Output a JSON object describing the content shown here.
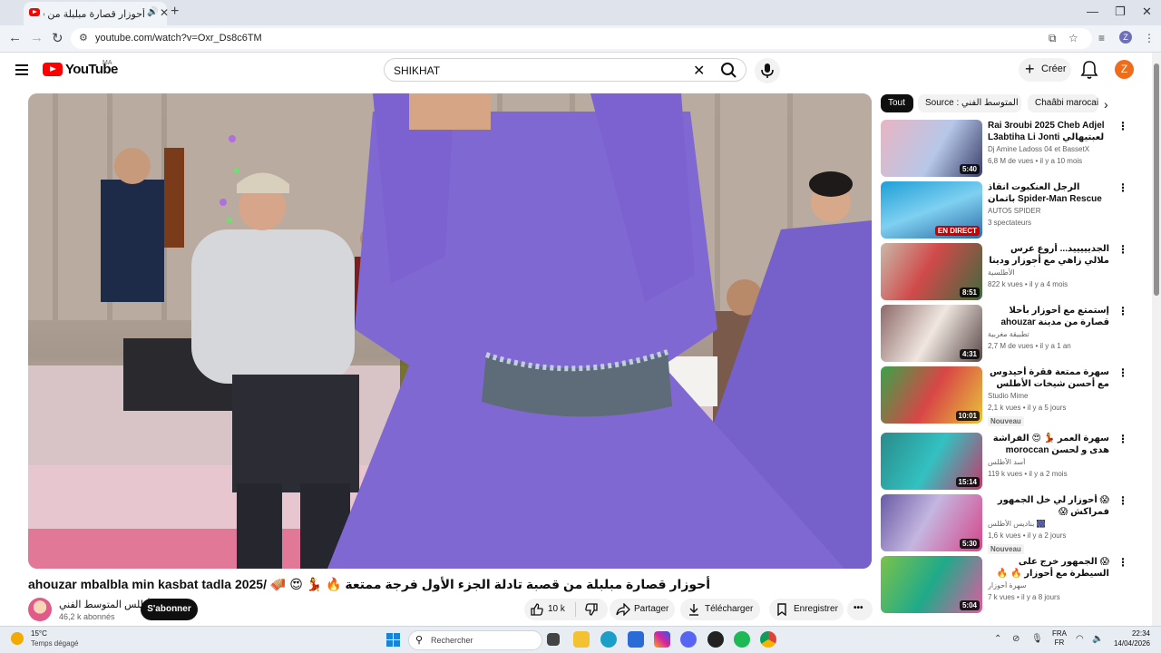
{
  "browser": {
    "tab_title": "أحوزار قصارة مبلبلة من قصب",
    "new_tab": "+",
    "url": "youtube.com/watch?v=Oxr_Ds8c6TM",
    "profile_initial": "Z"
  },
  "youtube": {
    "logo_text": "YouTube",
    "region": "MA",
    "search_query": "SHIKHAT",
    "create_label": "Créer",
    "avatar_initial": "Z"
  },
  "video": {
    "title": "ahouzar mbalbla min kasbat tadla 2025/ 🪗 😍 💃 🔥 أحوزار قصارة مبلبلة من قصبة تادلة الجزء الأول فرجة ممتعة",
    "channel_name": "الأطلس المتوسط الفني",
    "subscribers": "46,2 k abonnés",
    "subscribe_label": "S'abonner",
    "likes": "10 k",
    "share_label": "Partager",
    "download_label": "Télécharger",
    "save_label": "Enregistrer",
    "more_label": "•••"
  },
  "chips": [
    "Tout",
    "Source : الأطلس المتوسط الفني",
    "Chaâbi marocain"
  ],
  "recommendations": [
    {
      "title": "Rai 3roubi 2025 Cheb Adjel L3abtiha Li Jonti لعبتيهالي جونتي",
      "channel": "Dj Amine Ladoss 04 et BassetX",
      "meta": "6,8 M de vues • il y a 10 mois",
      "duration": "5:40",
      "badge": "",
      "rtl": false
    },
    {
      "title": "الرجل العنكبوت انقاذ باتمان Spider-Man Rescue batman vs iron man vs...",
      "channel": "AUTO5 SPIDER",
      "meta": "3 spectateurs",
      "duration": "EN DIRECT",
      "badge": "",
      "rtl": false
    },
    {
      "title": "الجديييييد... أروع عرس ملالي زاهي مع أحوزار ودينا النشاط [ الجزء الأول...]",
      "channel": "الأطلسية",
      "meta": "822 k vues • il y a 4 mois",
      "duration": "8:51",
      "badge": "",
      "rtl": true
    },
    {
      "title": "إستمتع مع أحوزار بأحلا قصارة من مدينة ahouzar ahla/ ميدلت فرجة ممتعة",
      "channel": "تطبيقة مغربية",
      "meta": "2,7 M de vues • il y a 1 an",
      "duration": "4:31",
      "badge": "",
      "rtl": true
    },
    {
      "title": "سهرة ممتعة فقرة أحيدوس مع أحسن شيخات الأطلس 🔥 فرجة ممتعة لعشاق النشاط 🪗",
      "channel": "Studio Mime",
      "meta": "2,1 k vues • il y a 5 jours",
      "duration": "10:01",
      "badge": "Nouveau",
      "rtl": true
    },
    {
      "title": "سهرة العمر 💃 😍 الفراشة هدى و لحسن moroccan dance deep/ الخنيفري",
      "channel": "أسد الأطلس",
      "meta": "119 k vues • il y a 2 mois",
      "duration": "15:14",
      "badge": "",
      "rtl": true
    },
    {
      "title": "😱 أحوزار لي خل الجمهور فمراكش 😱",
      "channel": "🎆 بناديس الأطلس",
      "meta": "1,6 k vues • il y a 2 jours",
      "duration": "5:30",
      "badge": "Nouveau",
      "rtl": true
    },
    {
      "title": "😱 الجمهور خرج على السيطرة مع أحوزار 🔥 🔥",
      "channel": "سهرة أحوزار",
      "meta": "7 k vues • il y a 8 jours",
      "duration": "5:04",
      "badge": "",
      "rtl": true
    }
  ],
  "taskbar": {
    "temperature": "15°C",
    "weather": "Temps dégagé",
    "search_label": "Rechercher",
    "lang_1": "FRA",
    "lang_2": "FR",
    "time": "22:34",
    "date": "14/04/2026"
  },
  "icons": {
    "menu": "menu-icon",
    "search": "search-icon",
    "mic": "mic-icon",
    "bell": "bell-icon",
    "like": "thumb-up-icon",
    "dislike": "thumb-down-icon",
    "share": "share-icon",
    "download": "download-icon",
    "save": "bookmark-icon"
  },
  "colors": {
    "brand": "#ff0000",
    "accent_avatar": "#ef6c1a",
    "subscribe_bg": "#0f0f0f"
  }
}
